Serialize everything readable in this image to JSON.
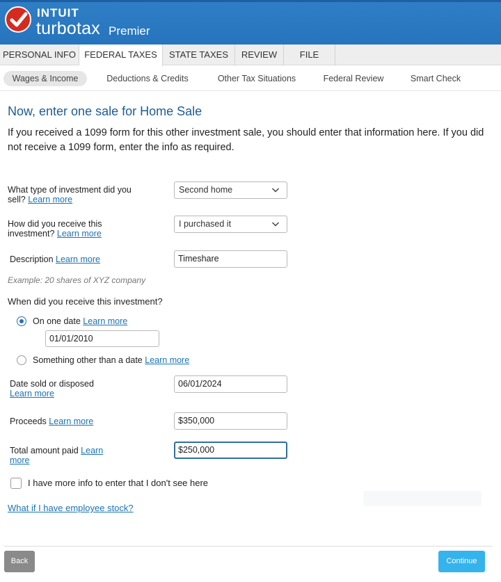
{
  "brand": {
    "company": "INTUIT",
    "product": "turbotax",
    "edition": "Premier"
  },
  "main_tabs": [
    {
      "label": "PERSONAL INFO"
    },
    {
      "label": "FEDERAL TAXES",
      "active": true
    },
    {
      "label": "STATE TAXES"
    },
    {
      "label": "REVIEW"
    },
    {
      "label": "FILE"
    }
  ],
  "sub_tabs": [
    {
      "label": "Wages & Income",
      "active": true
    },
    {
      "label": "Deductions & Credits"
    },
    {
      "label": "Other Tax Situations"
    },
    {
      "label": "Federal Review"
    },
    {
      "label": "Smart Check"
    }
  ],
  "page": {
    "title": "Now, enter one sale for Home Sale",
    "intro": "If you received a 1099 form for this other investment sale, you should enter that information here. If you did not receive a 1099 form, enter the info as required."
  },
  "form": {
    "learn_more": "Learn more",
    "investment_type": {
      "label_line1": "What type of investment did you",
      "label_line2": "sell?",
      "value": "Second home"
    },
    "received_how": {
      "label_line1": "How did you receive this",
      "label_line2": "investment?",
      "value": "I purchased it"
    },
    "description": {
      "label": "Description",
      "value": "Timeshare",
      "example": "Example: 20 shares of XYZ company"
    },
    "received_when": {
      "question": "When did you receive this investment?",
      "option_date": "On one date",
      "date_value": "01/01/2010",
      "option_other": "Something other than a date",
      "selected": "On one date"
    },
    "date_sold": {
      "label": "Date sold or disposed",
      "value": "06/01/2024"
    },
    "proceeds": {
      "label": "Proceeds",
      "value": "$350,000"
    },
    "total_paid": {
      "label": "Total amount paid",
      "link_part1": "Learn",
      "link_part2": "more",
      "value": "$250,000"
    },
    "more_info": {
      "label": "I have more info to enter that I don't see here",
      "checked": false
    },
    "employee_stock_link": "What if I have employee stock?"
  },
  "footer": {
    "back": "Back",
    "continue": "Continue"
  },
  "colors": {
    "header": "#2674bd",
    "title": "#1b5d96",
    "link": "#1a73b5",
    "continue": "#35b3ec",
    "back": "#8a8a8a",
    "logo": "#d52b1e"
  }
}
